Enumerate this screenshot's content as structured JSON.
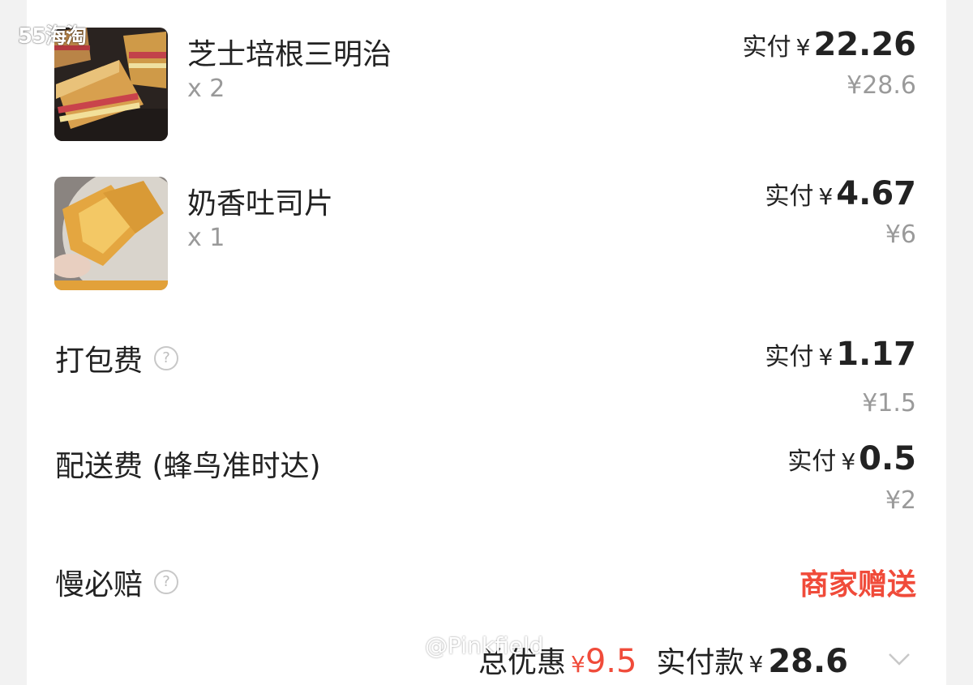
{
  "watermark_top": "55海淘",
  "watermark_user": "@Pinkfield",
  "items": [
    {
      "name": "芝士培根三明治",
      "qty": "x 2",
      "paid_prefix": "实付",
      "paid_currency": "¥",
      "paid_amount": "22.26",
      "original": "¥28.6",
      "image": "sandwich-image"
    },
    {
      "name": "奶香吐司片",
      "qty": "x 1",
      "paid_prefix": "实付",
      "paid_currency": "¥",
      "paid_amount": "4.67",
      "original": "¥6",
      "image": "toast-image"
    }
  ],
  "fees": {
    "packing": {
      "label": "打包费",
      "paid_prefix": "实付",
      "paid_currency": "¥",
      "paid_amount": "1.17",
      "original": "¥1.5"
    },
    "delivery": {
      "label": "配送费 (蜂鸟准时达)",
      "paid_prefix": "实付",
      "paid_currency": "¥",
      "paid_amount": "0.5",
      "original": "¥2"
    },
    "slow_compensation": {
      "label": "慢必赔",
      "value": "商家赠送"
    }
  },
  "summary": {
    "discount_label": "总优惠",
    "discount_currency": "¥",
    "discount_amount": "9.5",
    "paid_label": "实付款",
    "paid_currency": "¥",
    "paid_amount": "28.6"
  },
  "colors": {
    "accent_red": "#f04b3a",
    "muted_gray": "#9a9a9a"
  },
  "icons": [
    "help-icon",
    "chevron-down-icon"
  ]
}
